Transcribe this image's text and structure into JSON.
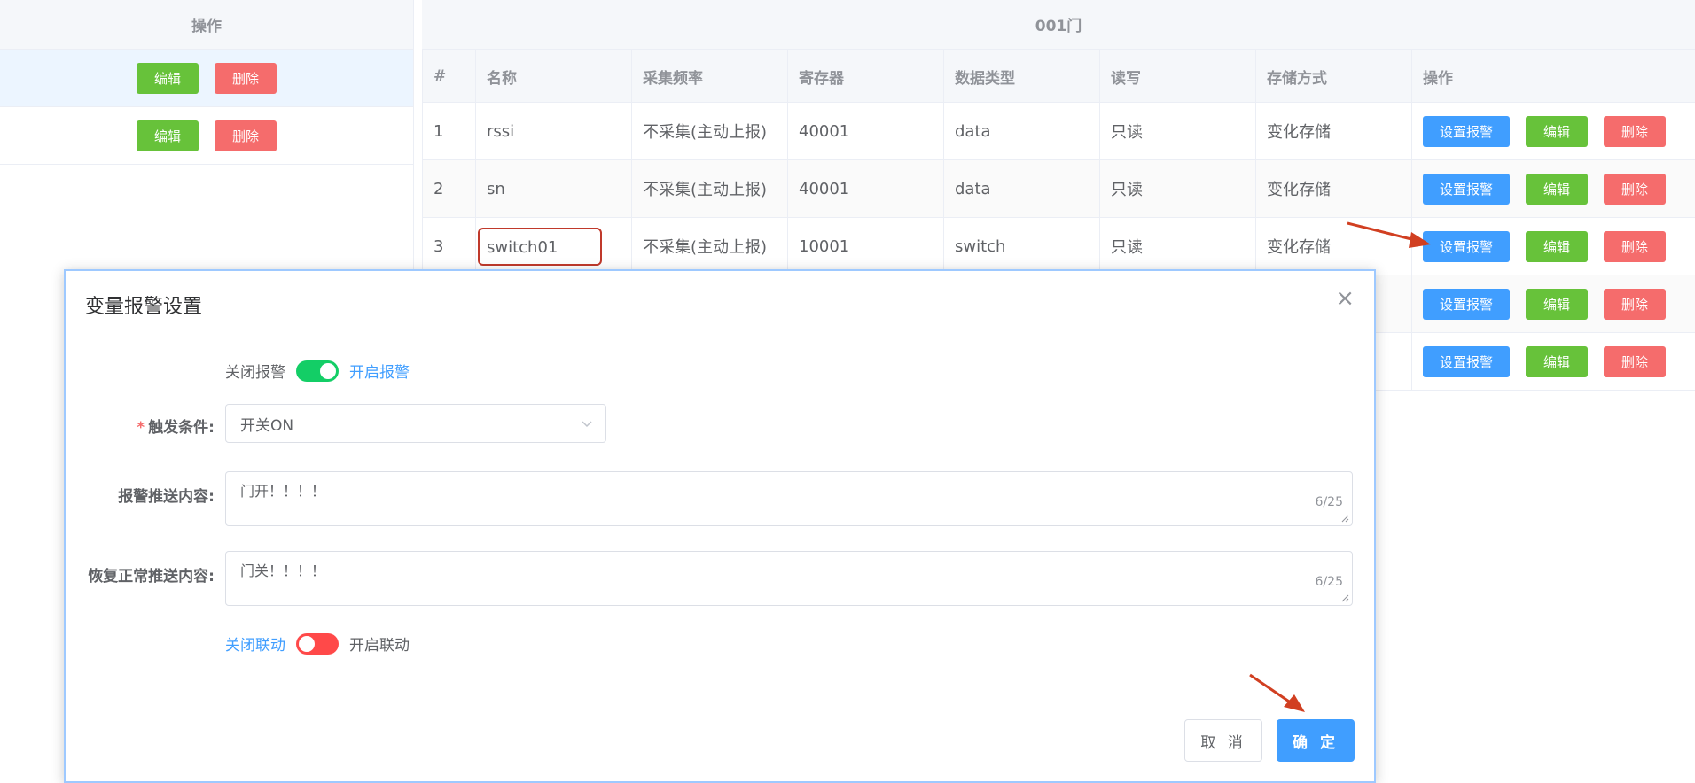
{
  "left_panel": {
    "header": "操作",
    "rows": [
      {
        "edit": "编辑",
        "delete": "删除"
      },
      {
        "edit": "编辑",
        "delete": "删除"
      }
    ]
  },
  "table": {
    "title": "001门",
    "columns": [
      "#",
      "名称",
      "采集频率",
      "寄存器",
      "数据类型",
      "读写",
      "存储方式",
      "操作"
    ],
    "rows": [
      {
        "index": "1",
        "name": "rssi",
        "freq": "不采集(主动上报)",
        "register": "40001",
        "type": "data",
        "rw": "只读",
        "storage": "变化存储"
      },
      {
        "index": "2",
        "name": "sn",
        "freq": "不采集(主动上报)",
        "register": "40001",
        "type": "data",
        "rw": "只读",
        "storage": "变化存储"
      },
      {
        "index": "3",
        "name": "switch01",
        "freq": "不采集(主动上报)",
        "register": "10001",
        "type": "switch",
        "rw": "只读",
        "storage": "变化存储"
      }
    ],
    "actions": {
      "alarm": "设置报警",
      "edit": "编辑",
      "delete": "删除"
    }
  },
  "dialog": {
    "title": "变量报警设置",
    "alarm_switch": {
      "off_label": "关闭报警",
      "on_label": "开启报警",
      "state": "on"
    },
    "trigger": {
      "label": "触发条件:",
      "value": "开关ON"
    },
    "push_content": {
      "label": "报警推送内容:",
      "value": "门开！！！！",
      "counter": "6/25"
    },
    "recover_content": {
      "label": "恢复正常推送内容:",
      "value": "门关！！！！",
      "counter": "6/25"
    },
    "link_switch": {
      "off_label": "关闭联动",
      "on_label": "开启联动",
      "state": "off"
    },
    "cancel": "取 消",
    "confirm": "确 定"
  },
  "colors": {
    "primary": "#409eff",
    "success": "#67c23a",
    "danger": "#f56c6c",
    "toggle_on": "#13ce66",
    "toggle_off": "#ff4949",
    "annotation": "#d13f21"
  }
}
